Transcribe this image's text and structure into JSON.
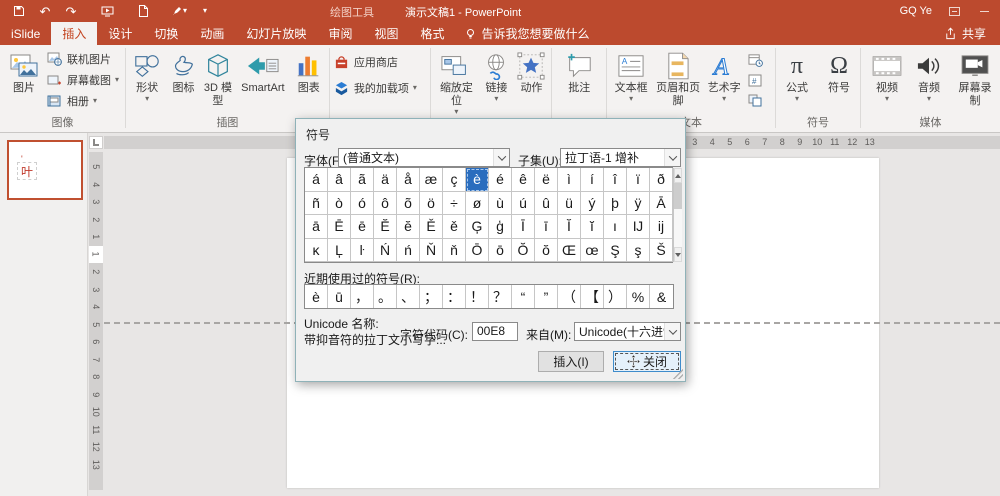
{
  "icons": {
    "dropdown": "▾",
    "undo": "↶",
    "redo": "↷",
    "pi": "π",
    "omega": "Ω"
  },
  "titlebar": {
    "context_title": "绘图工具",
    "doc_title": "演示文稿1 - PowerPoint",
    "user": "GQ Ye",
    "share_label": "共享",
    "tellme_label": "告诉我您想要做什么"
  },
  "tabs": [
    {
      "label": "iSlide"
    },
    {
      "label": "插入",
      "active": true
    },
    {
      "label": "设计"
    },
    {
      "label": "切换"
    },
    {
      "label": "动画"
    },
    {
      "label": "幻灯片放映"
    },
    {
      "label": "审阅"
    },
    {
      "label": "视图"
    },
    {
      "label": "格式"
    }
  ],
  "ribbon": {
    "group_labels": {
      "images": "图像",
      "illustrations": "插图",
      "addins": "",
      "links": "",
      "comments": "",
      "text": "文本",
      "symbols": "符号",
      "media": "媒体"
    },
    "buttons": {
      "picture": "图片",
      "online_pictures": "联机图片",
      "screenshot": "屏幕截图",
      "photo_album": "相册",
      "shapes": "形状",
      "icons": "图标",
      "model3d": "3D 模型",
      "smartart": "SmartArt",
      "chart": "图表",
      "app_store": "应用商店",
      "my_addins": "我的加载项",
      "zoom_link": "缩放定位",
      "link": "链接",
      "action": "动作",
      "comment": "批注",
      "text_box": "文本框",
      "header_footer": "页眉和页脚",
      "wordart": "艺术字",
      "equation": "公式",
      "symbol": "符号",
      "video": "视频",
      "audio": "音频",
      "screen_rec": "屏幕录制"
    }
  },
  "slides_panel": {
    "thumbnail_text": "叶",
    "thumbnail_quote": "'"
  },
  "rulers": {
    "h_numbers": [
      "3",
      "4",
      "5",
      "6",
      "7",
      "8",
      "9",
      "10",
      "11",
      "12",
      "13"
    ],
    "v_numbers": [
      {
        "n": "5"
      },
      {
        "n": "4"
      },
      {
        "n": "3"
      },
      {
        "n": "2"
      },
      {
        "n": "1"
      },
      {
        "n": "1",
        "hl": true
      },
      {
        "n": "2"
      },
      {
        "n": "3"
      },
      {
        "n": "4"
      },
      {
        "n": "5"
      },
      {
        "n": "6"
      },
      {
        "n": "7"
      },
      {
        "n": "8"
      },
      {
        "n": "9"
      },
      {
        "n": "10"
      },
      {
        "n": "11"
      },
      {
        "n": "12"
      },
      {
        "n": "13"
      }
    ]
  },
  "dialog": {
    "title": "符号",
    "font_label": "字体(F):",
    "font_value": "(普通文本)",
    "subset_label": "子集(U):",
    "subset_value": "拉丁语-1 增补",
    "grid": {
      "cells": [
        "á",
        "â",
        "ã",
        "ä",
        "å",
        "æ",
        "ç",
        "è",
        "é",
        "ê",
        "ë",
        "ì",
        "í",
        "î",
        "ï",
        "ð",
        "ñ",
        "ò",
        "ó",
        "ô",
        "õ",
        "ö",
        "÷",
        "ø",
        "ù",
        "ú",
        "û",
        "ü",
        "ý",
        "þ",
        "ÿ",
        "Ā",
        "ā",
        "Ē",
        "ē",
        "Ĕ",
        "ĕ",
        "Ě",
        "ě",
        "Ģ",
        "ģ",
        "Ī",
        "ī",
        "Ĭ",
        "ĭ",
        "ı",
        "Ĳ",
        "ĳ",
        "ĸ",
        "Ļ",
        "ŀ",
        "Ń",
        "ń",
        "Ň",
        "ň",
        "Ō",
        "ō",
        "Ŏ",
        "ŏ",
        "Œ",
        "œ",
        "Ş",
        "ş",
        "Š"
      ],
      "selected_index": 7,
      "selected_symbol": "è"
    },
    "recent_label": "近期使用过的符号(R):",
    "recent_cells": [
      "è",
      "ū",
      "，",
      "。",
      "、",
      "；",
      "：",
      "！",
      "？",
      "“",
      "”",
      "（",
      "【",
      "）",
      "%",
      "&"
    ],
    "unicode_name_label": "Unicode 名称:",
    "unicode_name_value": "带抑音符的拉丁文小写字...",
    "char_code_label": "字符代码(C):",
    "char_code_value": "00E8",
    "from_label": "来自(M):",
    "from_value": "Unicode(十六进制)",
    "insert_button": "插入(I)",
    "close_button": "关闭"
  }
}
